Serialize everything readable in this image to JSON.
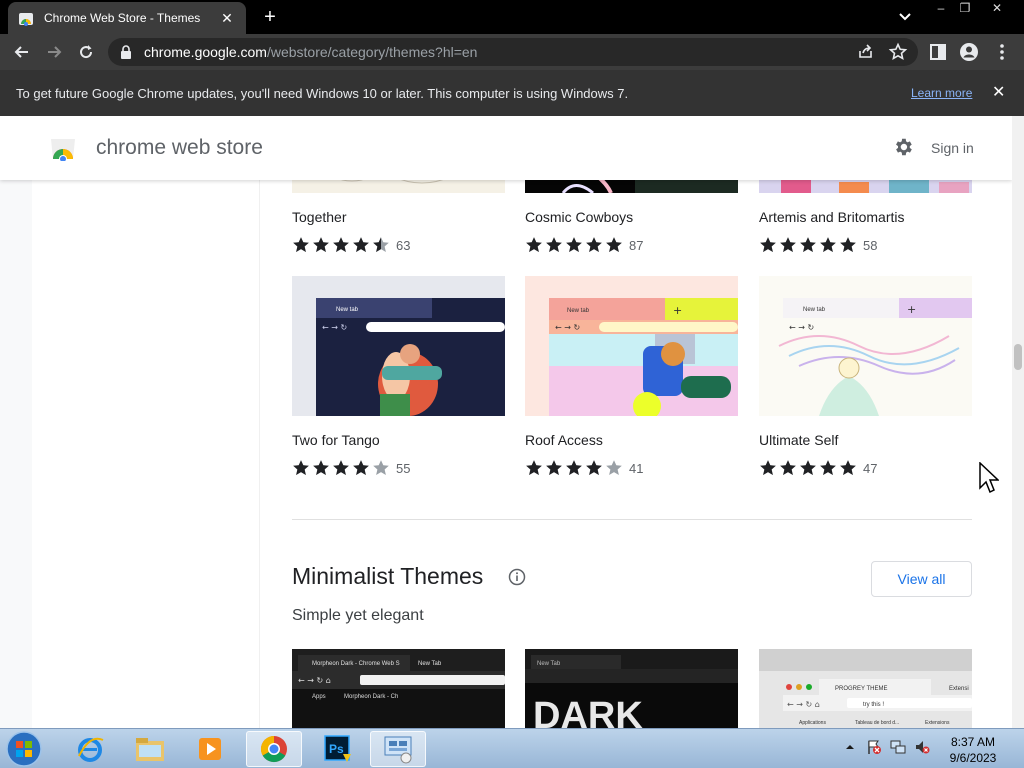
{
  "browser": {
    "tab_title": "Chrome Web Store - Themes",
    "tab_close": "✕",
    "new_tab": "+",
    "window_controls": {
      "minimize": "–",
      "maximize": "❐",
      "close": "✕"
    },
    "url_host": "chrome.google.com",
    "url_path": "/webstore/category/themes?hl=en"
  },
  "infobar": {
    "message": "To get future Google Chrome updates, you'll need Windows 10 or later. This computer is using Windows 7.",
    "link": "Learn more",
    "close": "✕"
  },
  "store": {
    "title": "chrome web store",
    "sign_in": "Sign in"
  },
  "themes": [
    {
      "name": "Together",
      "rating": 4.5,
      "count": "63"
    },
    {
      "name": "Cosmic Cowboys",
      "rating": 5,
      "count": "87"
    },
    {
      "name": "Artemis and Britomartis",
      "rating": 5,
      "count": "58"
    },
    {
      "name": "Two for Tango",
      "rating": 4,
      "count": "55"
    },
    {
      "name": "Roof Access",
      "rating": 4,
      "count": "41"
    },
    {
      "name": "Ultimate Self",
      "rating": 5,
      "count": "47"
    }
  ],
  "section": {
    "title": "Minimalist Themes",
    "subtitle": "Simple yet elegant",
    "view_all": "View all"
  },
  "thumb_text": {
    "new_tab": "New tab",
    "morpheon_tab": "Morpheon Dark - Chrome Web S",
    "morpheon_newtab": "New Tab",
    "apps": "Apps",
    "morpheon_bookmark": "Morpheon Dark - Ch",
    "dark_newtab": "New Tab",
    "dark_word": "DARK",
    "progrey_tab": "PROGREY THEME",
    "progrey_tab2": "Extensi",
    "progrey_search": "try this !",
    "progrey_bm1": "Applications",
    "progrey_bm2": "Tableau de bord d...",
    "progrey_bm3": "Extensions"
  },
  "taskbar": {
    "time": "8:37 AM",
    "date": "9/6/2023"
  },
  "colors": {
    "star": "#202124",
    "star_empty": "#9aa0a6",
    "accent": "#1a73e8"
  }
}
